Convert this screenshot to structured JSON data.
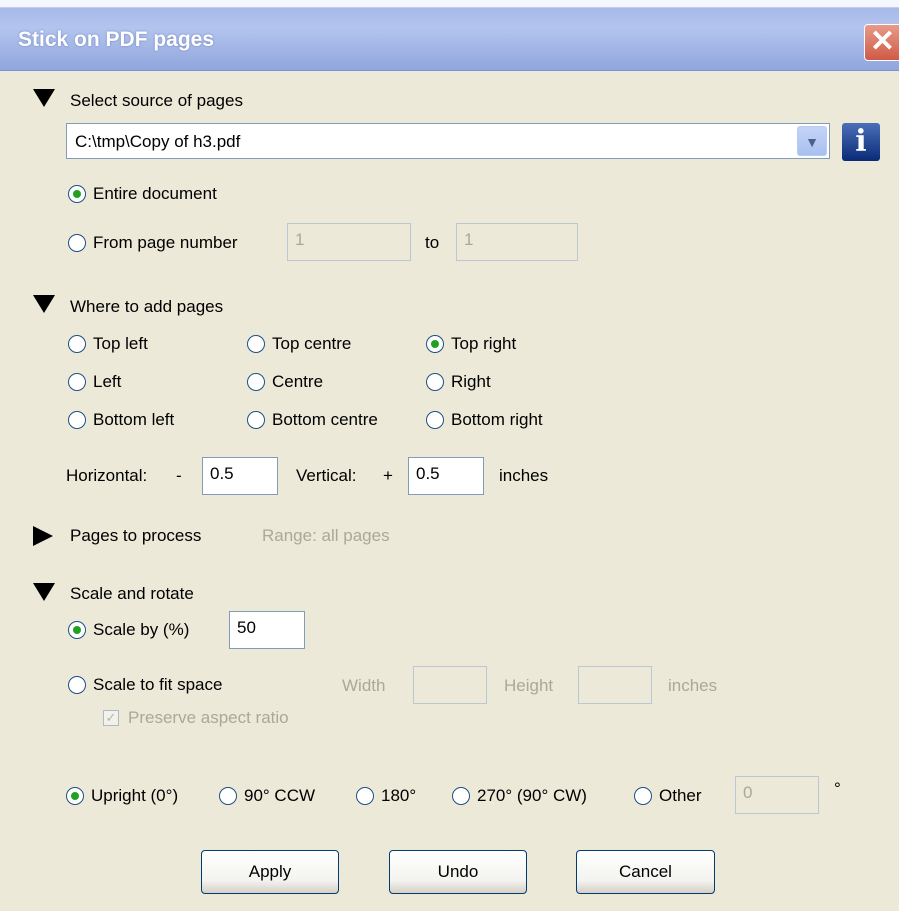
{
  "window": {
    "title": "Stick on PDF pages",
    "close_glyph": "✕"
  },
  "source": {
    "heading": "Select source of pages",
    "file": "C:\\tmp\\Copy of h3.pdf",
    "info_glyph": "i",
    "entire_document": "Entire document",
    "from_page": "From page number",
    "from_value": "1",
    "to_label": "to",
    "to_value": "1"
  },
  "placement": {
    "heading": "Where to add pages",
    "positions": [
      "Top left",
      "Top centre",
      "Top right",
      "Left",
      "Centre",
      "Right",
      "Bottom left",
      "Bottom centre",
      "Bottom right"
    ],
    "selected": "Top right",
    "horizontal_label": "Horizontal:",
    "horizontal_sign": "-",
    "horizontal_value": "0.5",
    "vertical_label": "Vertical:",
    "vertical_sign": "+",
    "vertical_value": "0.5",
    "units": "inches"
  },
  "pages": {
    "heading": "Pages to process",
    "range": "Range: all pages"
  },
  "scale": {
    "heading": "Scale and rotate",
    "scale_by": "Scale by (%)",
    "scale_value": "50",
    "scale_fit": "Scale to fit space",
    "width_label": "Width",
    "height_label": "Height",
    "units": "inches",
    "preserve": "Preserve aspect ratio",
    "check_glyph": "✓"
  },
  "rotation": {
    "options": [
      "Upright (0°)",
      "90° CCW",
      "180°",
      "270° (90° CW)",
      "Other"
    ],
    "selected": "Upright (0°)",
    "other_value": "0",
    "degree_symbol": "°"
  },
  "buttons": {
    "apply": "Apply",
    "undo": "Undo",
    "cancel": "Cancel"
  }
}
